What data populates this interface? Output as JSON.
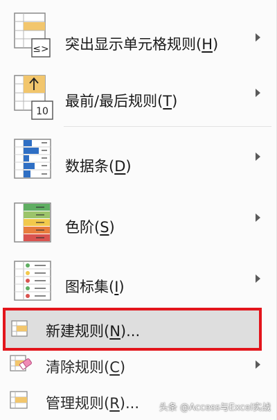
{
  "menu": {
    "items": [
      {
        "label": "突出显示单元格规则(",
        "mnemonic": "H",
        "suffix": ")",
        "icon": "highlight-cells-rules-icon",
        "icon_text": "≤>",
        "has_submenu": true
      },
      {
        "label": "最前/最后规则(",
        "mnemonic": "T",
        "suffix": ")",
        "icon": "top-bottom-rules-icon",
        "icon_text": "10",
        "has_submenu": true
      },
      {
        "label": "数据条(",
        "mnemonic": "D",
        "suffix": ")",
        "icon": "data-bars-icon",
        "has_submenu": true
      },
      {
        "label": "色阶(",
        "mnemonic": "S",
        "suffix": ")",
        "icon": "color-scales-icon",
        "has_submenu": true
      },
      {
        "label": "图标集(",
        "mnemonic": "I",
        "suffix": ")",
        "icon": "icon-sets-icon",
        "has_submenu": true
      },
      {
        "label": "新建规则(",
        "mnemonic": "N",
        "suffix": ")...",
        "icon": "new-rule-icon",
        "has_submenu": false,
        "highlighted": true
      },
      {
        "label": "清除规则(",
        "mnemonic": "C",
        "suffix": ")",
        "icon": "clear-rules-icon",
        "has_submenu": true
      },
      {
        "label": "管理规则(",
        "mnemonic": "R",
        "suffix": ")...",
        "icon": "manage-rules-icon",
        "has_submenu": false
      }
    ]
  },
  "colors": {
    "highlight_border": "#e3151c",
    "highlight_fill": "#dedede",
    "data_bar": "#2f6fc4",
    "arrow_fill": "#f2c66d",
    "scale_green": "#5fae62",
    "scale_yellow": "#f2c94c",
    "scale_orange": "#e87d3e",
    "scale_red": "#d9534f"
  },
  "watermark": "头条 @Access与Excel实战"
}
